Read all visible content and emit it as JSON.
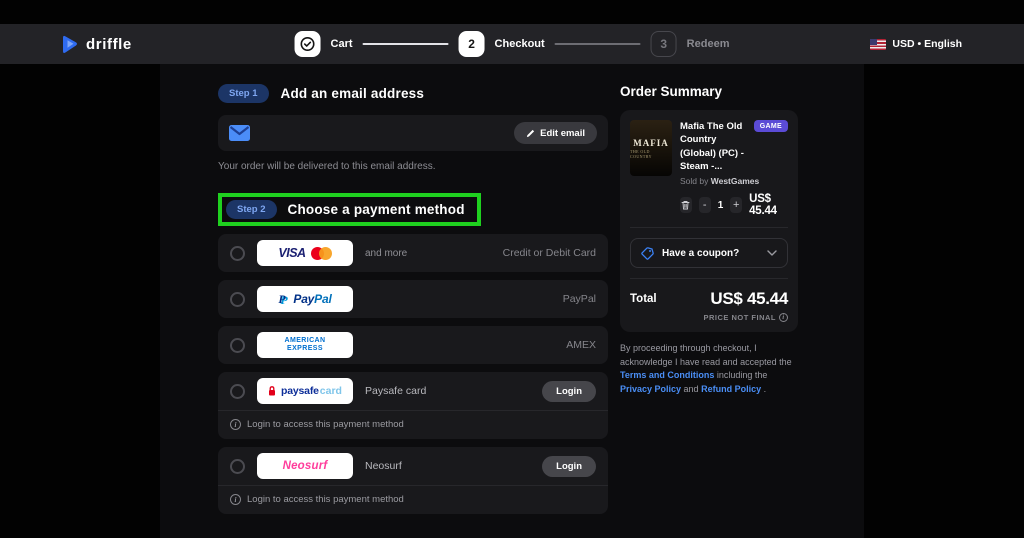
{
  "navbar": {
    "brand": "driffle",
    "steps": [
      {
        "indicator": "",
        "label": "Cart"
      },
      {
        "indicator": "2",
        "label": "Checkout"
      },
      {
        "indicator": "3",
        "label": "Redeem"
      }
    ],
    "locale": "USD • English"
  },
  "email_section": {
    "badge": "Step 1",
    "title": "Add an email address",
    "edit_button": "Edit email",
    "note": "Your order will be delivered to this email address."
  },
  "payment_section": {
    "badge": "Step 2",
    "title": "Choose a payment method",
    "methods": [
      {
        "logo_text": "VISA",
        "caption": "and more",
        "right_label": "Credit or Debit Card"
      },
      {
        "logo_icon": "P",
        "logo_pay": "Pay",
        "logo_pal": "Pal",
        "right_label": "PayPal"
      },
      {
        "logo_line1": "AMERICAN",
        "logo_line2": "EXPRESS",
        "right_label": "AMEX"
      },
      {
        "logo_brand": "paysafe",
        "logo_suffix": "card",
        "caption": "Paysafe card",
        "login_label": "Login",
        "note": "Login to access this payment method"
      },
      {
        "logo_text": "Neosurf",
        "caption": "Neosurf",
        "login_label": "Login",
        "note": "Login to access this payment method"
      }
    ]
  },
  "order_summary": {
    "title": "Order Summary",
    "product": {
      "name": "Mafia The Old Country (Global) (PC) - Steam -...",
      "badge": "GAME",
      "sold_by_label": "Sold by ",
      "seller": "WestGames",
      "quantity": "1",
      "minus": "-",
      "plus": "+",
      "price": "US$ 45.44",
      "thumb_title": "MAFIA",
      "thumb_subtitle": "THE OLD COUNTRY"
    },
    "coupon_label": "Have a coupon?",
    "total_label": "Total",
    "total_value": "US$ 45.44",
    "price_note": "PRICE NOT FINAL",
    "info_glyph": "i",
    "legal": {
      "prefix": "By proceeding through checkout, I acknowledge I have read and accepted the ",
      "link1": "Terms and Conditions",
      "mid1": " including the ",
      "link2": "Privacy Policy",
      "mid2": " and ",
      "link3": "Refund Policy",
      "suffix": " ."
    }
  },
  "colors": {
    "highlight_green": "#1fd11f",
    "accent_blue": "#3b82f6",
    "badge_purple": "#5b4bd6"
  }
}
